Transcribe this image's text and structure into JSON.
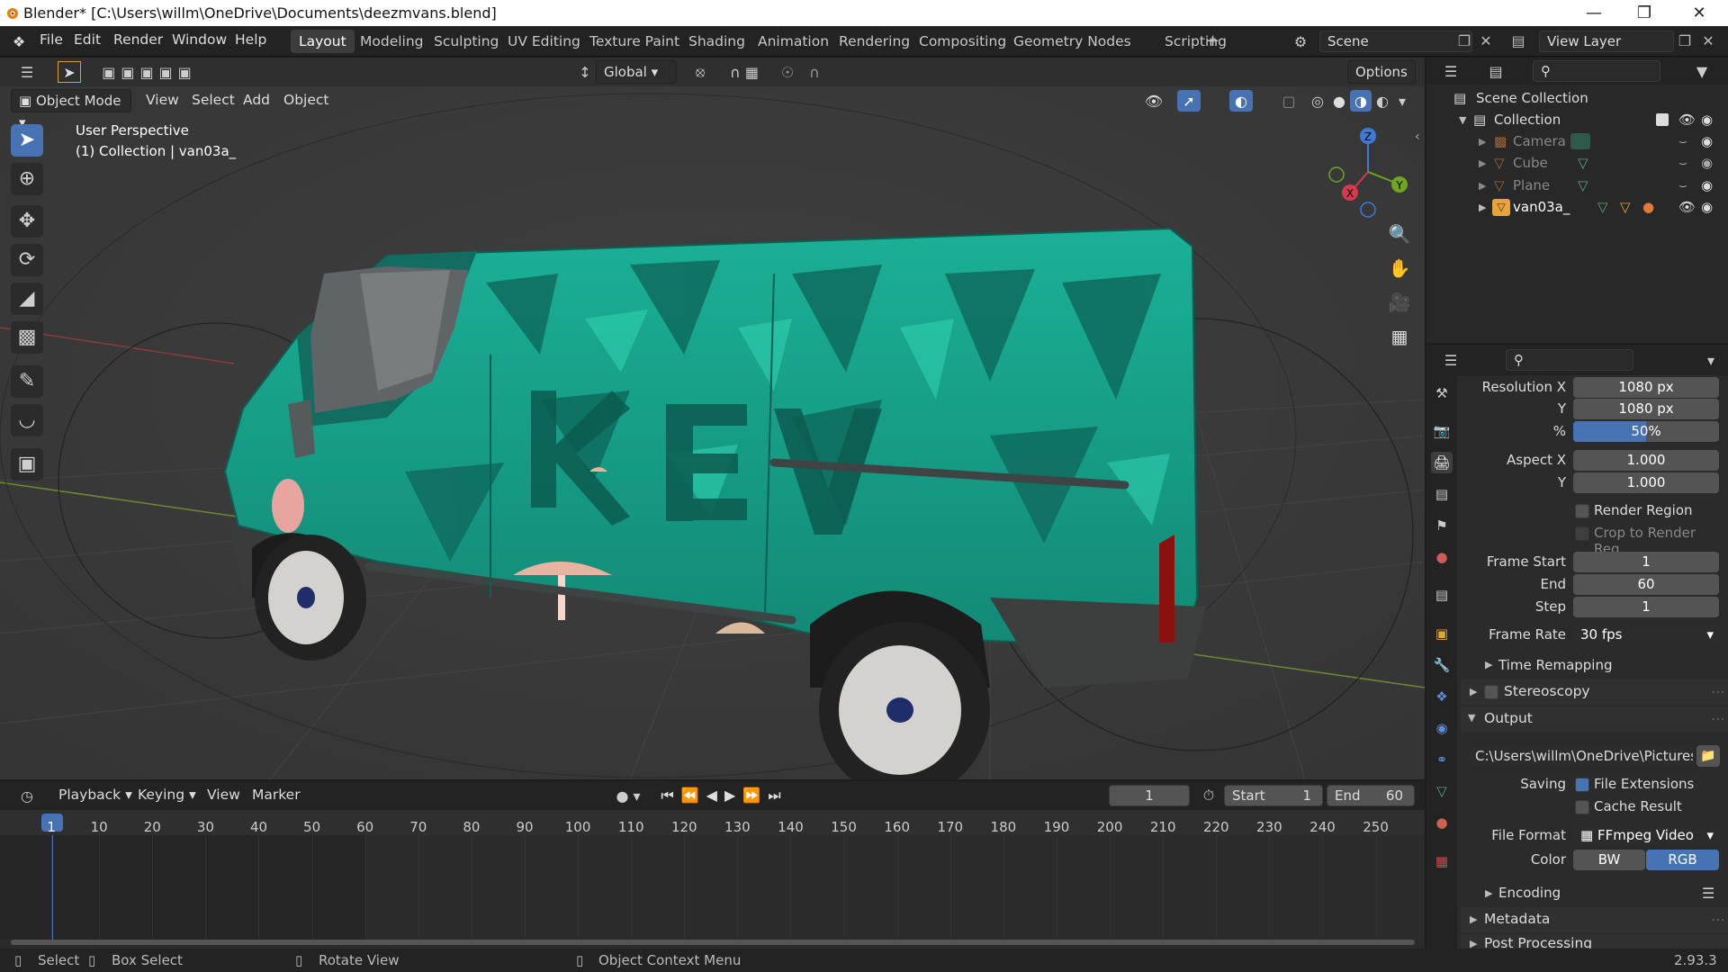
{
  "window": {
    "title": "Blender* [C:\\Users\\willm\\OneDrive\\Documents\\deezmvans.blend]"
  },
  "menu": [
    "File",
    "Edit",
    "Render",
    "Window",
    "Help"
  ],
  "workspaces": [
    "Layout",
    "Modeling",
    "Sculpting",
    "UV Editing",
    "Texture Paint",
    "Shading",
    "Animation",
    "Rendering",
    "Compositing",
    "Geometry Nodes",
    "Scripting"
  ],
  "active_workspace": "Layout",
  "scene": "Scene",
  "view_layer": "View Layer",
  "toolbar_header": {
    "transform_orientation": "Global",
    "options": "Options"
  },
  "viewport": {
    "mode": "Object Mode",
    "menus": [
      "View",
      "Select",
      "Add",
      "Object"
    ],
    "overlay_line1": "User Perspective",
    "overlay_line2": "(1) Collection | van03a_",
    "gizmo": {
      "x": "X",
      "y": "Y",
      "z": "Z"
    },
    "van_livery_colors": {
      "primary": "#1aa38a",
      "dark": "#0f5f54",
      "accent": "#e8b3a0"
    }
  },
  "outliner": {
    "root": "Scene Collection",
    "collection": "Collection",
    "items": [
      "Camera",
      "Cube",
      "Plane",
      "van03a_"
    ]
  },
  "properties": {
    "resolution_x_label": "Resolution X",
    "resolution_x": "1080 px",
    "y_label": "Y",
    "resolution_y": "1080 px",
    "percent_label": "%",
    "percent": "50%",
    "percent_value": 0.5,
    "aspect_x_label": "Aspect X",
    "aspect_x": "1.000",
    "aspect_y": "1.000",
    "render_region": "Render Region",
    "crop": "Crop to Render Reg...",
    "frame_start_label": "Frame Start",
    "frame_start": "1",
    "end_label": "End",
    "frame_end": "60",
    "step_label": "Step",
    "frame_step": "1",
    "frame_rate_label": "Frame Rate",
    "frame_rate": "30 fps",
    "time_remapping": "Time Remapping",
    "stereoscopy": "Stereoscopy",
    "output": "Output",
    "output_path": "C:\\Users\\willm\\OneDrive\\Pictures\\",
    "saving_label": "Saving",
    "file_extensions": "File Extensions",
    "cache_result": "Cache Result",
    "file_format_label": "File Format",
    "file_format": "FFmpeg Video",
    "color_label": "Color",
    "color_bw": "BW",
    "color_rgb": "RGB",
    "encoding": "Encoding",
    "metadata": "Metadata",
    "post_processing": "Post Processing"
  },
  "timeline": {
    "menus": [
      "Playback",
      "Keying",
      "View",
      "Marker"
    ],
    "current_frame": "1",
    "start_label": "Start",
    "start": "1",
    "end_label": "End",
    "end": "60",
    "ticks": [
      "1",
      "10",
      "20",
      "30",
      "40",
      "50",
      "60",
      "70",
      "80",
      "90",
      "100",
      "110",
      "120",
      "130",
      "140",
      "150",
      "160",
      "170",
      "180",
      "190",
      "200",
      "210",
      "220",
      "230",
      "240",
      "250"
    ]
  },
  "statusbar": {
    "select": "Select",
    "box_select": "Box Select",
    "rotate_view": "Rotate View",
    "context_menu": "Object Context Menu",
    "version": "2.93.3"
  }
}
